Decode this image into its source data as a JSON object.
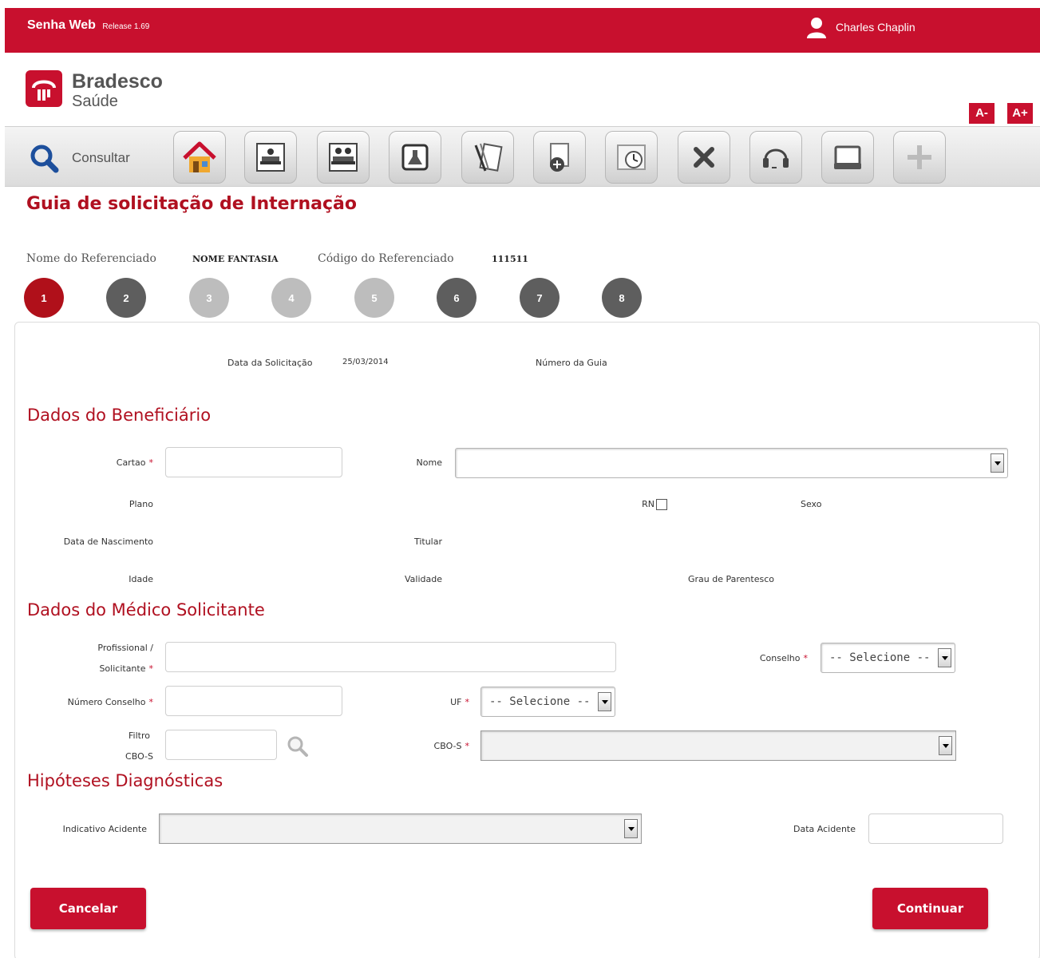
{
  "header": {
    "app_name": "Senha Web",
    "release": "Release 1.69",
    "user_name": "Charles Chaplin"
  },
  "logo": {
    "brand": "Bradesco",
    "sub": "Saúde"
  },
  "font_controls": {
    "decrease": "A-",
    "increase": "A+"
  },
  "toolbar": {
    "consultar_label": "Consultar",
    "icons": [
      "home-icon",
      "bed-patient-icon",
      "two-patients-bed-icon",
      "lab-flask-icon",
      "documents-pen-icon",
      "medication-icon",
      "clock-calendar-icon",
      "close-x-icon",
      "headset-icon",
      "printer-icon",
      "plus-icon"
    ]
  },
  "page": {
    "title": "Guia de solicitação de Internação",
    "ref_name_label": "Nome do Referenciado",
    "ref_name_value": "NOME FANTASIA",
    "ref_code_label": "Código do Referenciado",
    "ref_code_value": "111511"
  },
  "steps": [
    {
      "label": "1",
      "state": "active",
      "color": "#b0101a"
    },
    {
      "label": "2",
      "state": "enabled",
      "color": "#5e5e5e"
    },
    {
      "label": "3",
      "state": "disabled",
      "color": "#bdbdbd"
    },
    {
      "label": "4",
      "state": "disabled",
      "color": "#bdbdbd"
    },
    {
      "label": "5",
      "state": "disabled",
      "color": "#bdbdbd"
    },
    {
      "label": "6",
      "state": "enabled",
      "color": "#5e5e5e"
    },
    {
      "label": "7",
      "state": "enabled",
      "color": "#5e5e5e"
    },
    {
      "label": "8",
      "state": "enabled",
      "color": "#5e5e5e"
    }
  ],
  "form": {
    "data_solicitacao_label": "Data da Solicitação",
    "data_solicitacao_value": "25/03/2014",
    "numero_guia_label": "Número da Guia",
    "beneficiario": {
      "title": "Dados do Beneficiário",
      "cartao_label": "Cartao",
      "nome_label": "Nome",
      "plano_label": "Plano",
      "rn_label": "RN",
      "sexo_label": "Sexo",
      "nascimento_label": "Data de Nascimento",
      "titular_label": "Titular",
      "idade_label": "Idade",
      "validade_label": "Validade",
      "parentesco_label": "Grau de Parentesco"
    },
    "medico": {
      "title": "Dados do Médico Solicitante",
      "profissional_label_1": "Profissional /",
      "profissional_label_2": "Solicitante",
      "conselho_label": "Conselho",
      "conselho_value": "-- Selecione --",
      "numero_conselho_label": "Número Conselho",
      "uf_label": "UF",
      "uf_value": "-- Selecione --",
      "filtro_label_1": "Filtro",
      "filtro_label_2": "CBO-S",
      "cbos_label": "CBO-S"
    },
    "hipoteses": {
      "title": "Hipóteses Diagnósticas",
      "indicativo_label": "Indicativo Acidente",
      "data_acidente_label": "Data Acidente"
    },
    "required_mark": "*"
  },
  "actions": {
    "cancel": "Cancelar",
    "continue": "Continuar"
  },
  "colors": {
    "brand_red": "#c8102e",
    "title_red": "#b01020"
  }
}
